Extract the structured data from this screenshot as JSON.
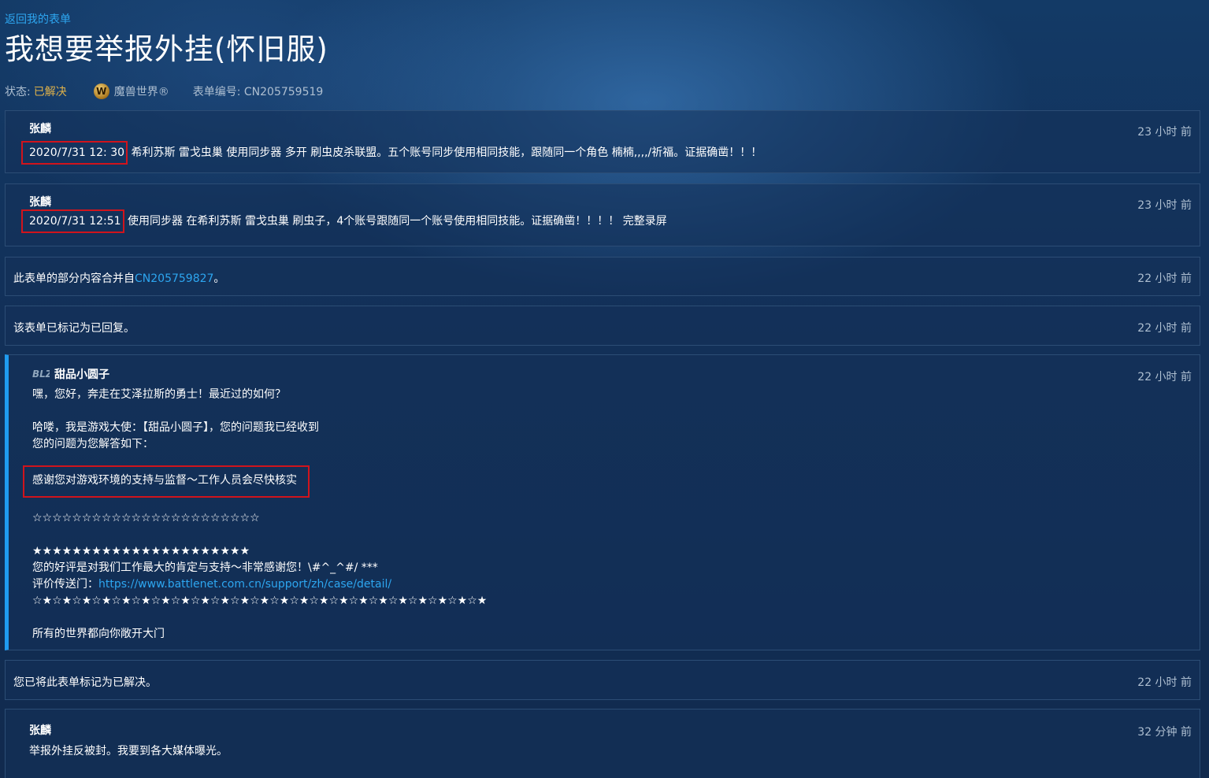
{
  "header": {
    "back_link": "返回我的表单",
    "title": "我想要举报外挂(怀旧服)",
    "status_label": "状态:",
    "status_value": "已解决",
    "game_name": "魔兽世界®",
    "case_label": "表单编号: CN205759519",
    "game_logo": "W"
  },
  "entries": [
    {
      "author": "张麟",
      "time": "23 小时 前",
      "highlight": "2020/7/31 12: 30",
      "text": "希利苏斯 雷戈虫巢 使用同步器 多开 刷虫皮杀联盟。五个账号同步使用相同技能，跟随同一个角色 楠楠,,,,/祈福。证据确凿！！！"
    },
    {
      "author": "张麟",
      "time": "23 小时 前",
      "highlight": "2020/7/31 12:51",
      "text": "使用同步器 在希利苏斯 雷戈虫巢 刷虫子，4个账号跟随同一个账号使用相同技能。证据确凿！！！！ 完整录屏"
    },
    {
      "text_prefix": "此表单的部分内容合并自",
      "link": "CN205759827",
      "text_suffix": "。",
      "time": "22 小时 前"
    },
    {
      "text": "该表单已标记为已回复。",
      "time": "22 小时 前"
    },
    {
      "author": "甜品小圆子",
      "time": "22 小时 前",
      "lines": {
        "l1": "嘿，您好，奔走在艾泽拉斯的勇士！最近过的如何？",
        "l2": "哈喽，我是游戏大使：【甜品小圆子】，您的问题我已经收到",
        "l3": "您的问题为您解答如下：",
        "l4": "感谢您对游戏环境的支持与监督～工作人员会尽快核实",
        "l5": "☆☆☆☆☆☆☆☆☆☆☆☆☆☆☆☆☆☆☆☆☆☆☆",
        "l6": "★★★★★★★★★★★★★★★★★★★★★★",
        "l7": "您的好评是对我们工作最大的肯定与支持～非常感谢您！\\#^_^#/ ***",
        "l8_label": "评价传送门：",
        "l8_link": "https://www.battlenet.com.cn/support/zh/case/detail/",
        "l9": "☆★☆★☆★☆★☆★☆★☆★☆★☆★☆★☆★☆★☆★☆★☆★☆★☆★☆★☆★☆★☆★☆★☆★",
        "l10": "所有的世界都向你敞开大门"
      }
    },
    {
      "text": "您已将此表单标记为已解决。",
      "time": "22 小时 前"
    },
    {
      "author": "张麟",
      "time": "32 分钟 前",
      "text": "举报外挂反被封。我要到各大媒体曝光。"
    }
  ]
}
